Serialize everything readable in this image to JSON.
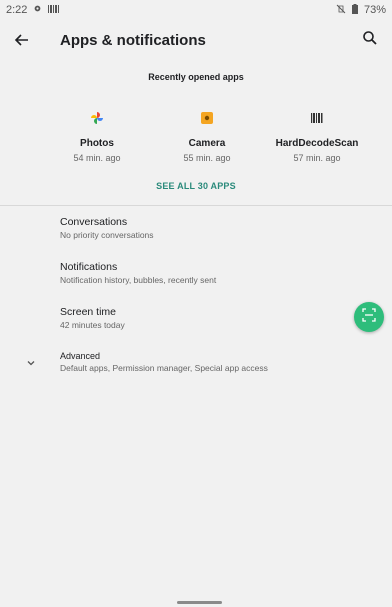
{
  "status": {
    "time": "2:22",
    "battery": "73%"
  },
  "header": {
    "title": "Apps & notifications"
  },
  "recent": {
    "title": "Recently opened apps",
    "apps": [
      {
        "name": "Photos",
        "time": "54 min. ago",
        "icon": "photos-icon"
      },
      {
        "name": "Camera",
        "time": "55 min. ago",
        "icon": "camera-icon"
      },
      {
        "name": "HardDecodeScan",
        "time": "57 min. ago",
        "icon": "barcode-icon"
      }
    ],
    "see_all": "SEE ALL 30 APPS"
  },
  "settings": [
    {
      "title": "Conversations",
      "subtitle": "No priority conversations"
    },
    {
      "title": "Notifications",
      "subtitle": "Notification history, bubbles, recently sent"
    },
    {
      "title": "Screen time",
      "subtitle": "42 minutes today"
    },
    {
      "title": "Advanced",
      "subtitle": "Default apps, Permission manager, Special app access"
    }
  ],
  "colors": {
    "accent": "#2a8a7b",
    "fab": "#2ebd7b",
    "background": "#f1f1f1"
  }
}
